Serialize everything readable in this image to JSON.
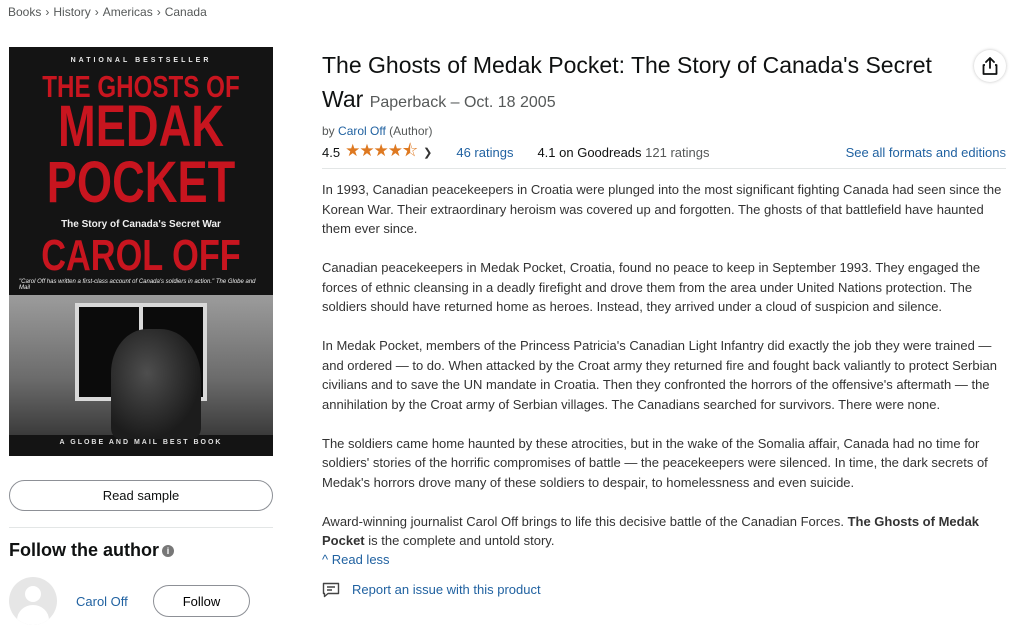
{
  "breadcrumb": [
    "Books",
    "History",
    "Americas",
    "Canada"
  ],
  "cover": {
    "top_line": "NATIONAL BESTSELLER",
    "title_line1": "THE GHOSTS OF",
    "title_line2": "MEDAK",
    "title_line3": "POCKET",
    "subtitle": "The Story of Canada's Secret War",
    "author": "CAROL OFF",
    "quote": "\"Carol Off has written a first-class account of Canada's soldiers in action.\" The Globe and Mail",
    "footer": "A GLOBE AND MAIL BEST BOOK"
  },
  "left": {
    "read_sample": "Read sample",
    "follow_heading": "Follow the author",
    "author_name": "Carol Off",
    "follow_button": "Follow"
  },
  "product": {
    "title": "The Ghosts of Medak Pocket: The Story of Canada's Secret War",
    "format": "Paperback – Oct. 18 2005",
    "by": "by",
    "author": "Carol Off",
    "author_role": "(Author)",
    "rating_value": "4.5",
    "stars": "★★★★⯪",
    "ratings_count": "46 ratings",
    "goodreads_score": "4.1 on Goodreads",
    "goodreads_count": "121 ratings",
    "formats_link": "See all formats and editions"
  },
  "description": {
    "p1": "In 1993, Canadian peacekeepers in Croatia were plunged into the most significant fighting Canada had seen since the Korean War. Their extraordinary heroism was covered up and forgotten. The ghosts of that battlefield have haunted them ever since.",
    "p2": "Canadian peacekeepers in Medak Pocket, Croatia, found no peace to keep in September 1993. They engaged the forces of ethnic cleansing in a deadly firefight and drove them from the area under United Nations protection. The soldiers should have returned home as heroes. Instead, they arrived under a cloud of suspicion and silence.",
    "p3": "In Medak Pocket, members of the Princess Patricia's Canadian Light Infantry did exactly the job they were trained — and ordered — to do. When attacked by the Croat army they returned fire and fought back valiantly to protect Serbian civilians and to save the UN mandate in Croatia. Then they confronted the horrors of the offensive's aftermath — the annihilation by the Croat army of Serbian villages. The Canadians searched for survivors. There were none.",
    "p4": "The soldiers came home haunted by these atrocities, but in the wake of the Somalia affair, Canada had no time for soldiers' stories of the horrific compromises of battle — the peacekeepers were silenced. In time, the dark secrets of Medak's horrors drove many of these soldiers to despair, to homelessness and even suicide.",
    "p5_start": "Award-winning journalist Carol Off brings to life this decisive battle of the Canadian Forces. ",
    "p5_bold": "The Ghosts of Medak Pocket",
    "p5_end": " is the complete and untold story.",
    "read_less": "Read less",
    "report": "Report an issue with this product"
  },
  "colors": {
    "link": "#2162a1",
    "star": "#de7921",
    "cover_red": "#c8151f"
  },
  "icons": [
    "share-icon",
    "info-icon",
    "chevron-down-icon",
    "chevron-up-icon",
    "report-icon",
    "avatar-placeholder"
  ]
}
